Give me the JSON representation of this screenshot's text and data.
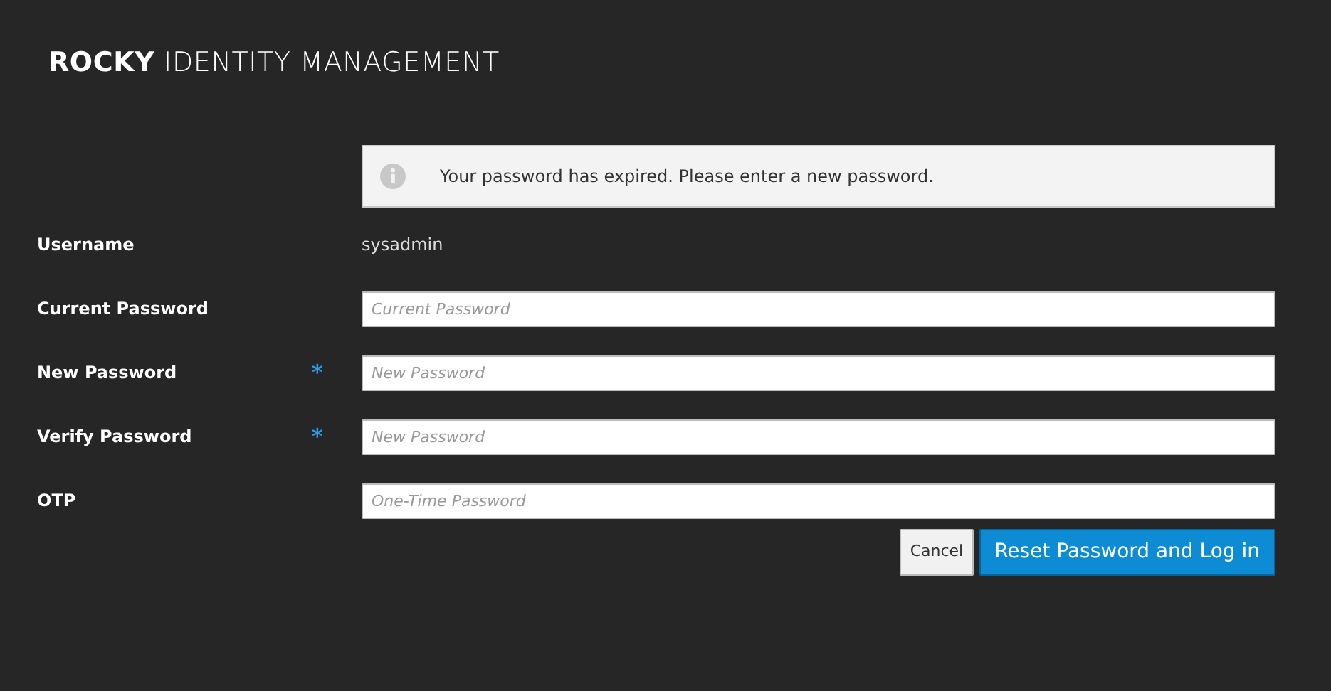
{
  "brand": "**ROCKY** IDENTITY MANAGEMENT",
  "alert": {
    "text": "Your password has expired. Please enter a new password."
  },
  "fields": [
    {
      "kind": "static",
      "label": "Username",
      "value": "sysadmin",
      "required": false
    },
    {
      "kind": "input",
      "label": "Current Password",
      "placeholder": "Current Password",
      "required": false
    },
    {
      "kind": "input",
      "label": "New Password",
      "placeholder": "New Password",
      "required": true
    },
    {
      "kind": "input",
      "label": "Verify Password",
      "placeholder": "New Password",
      "required": true
    },
    {
      "kind": "input",
      "label": "OTP",
      "placeholder": "One-Time Password",
      "required": false
    }
  ],
  "required_mark": "*",
  "buttons": [
    {
      "label": "Cancel",
      "kind": "default"
    },
    {
      "label": "Reset Password and Log in",
      "kind": "primary"
    }
  ]
}
